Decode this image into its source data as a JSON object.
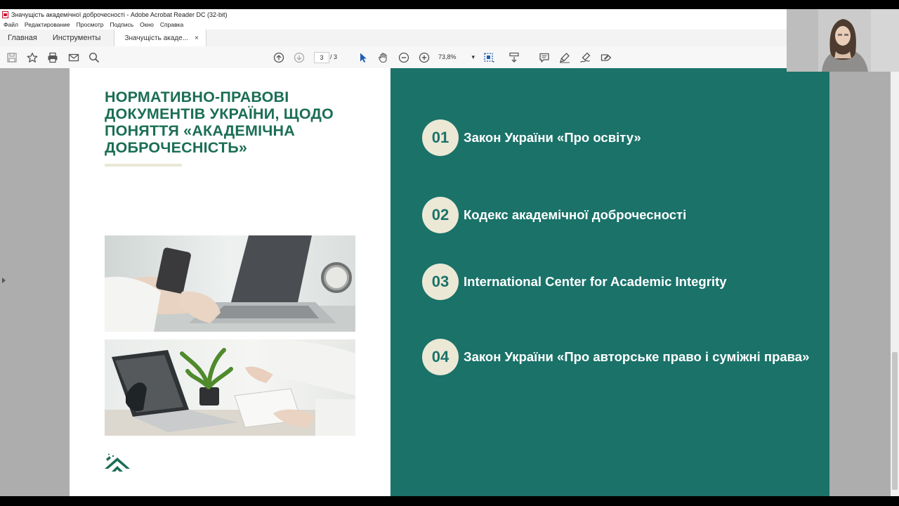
{
  "window": {
    "title": "Значущість академічної доброчесності - Adobe Acrobat Reader DC (32-bit)"
  },
  "menu": [
    "Файл",
    "Редактирование",
    "Просмотр",
    "Подпись",
    "Окно",
    "Справка"
  ],
  "tabs": {
    "home": "Главная",
    "tools": "Инструменты",
    "document": "Значущість акаде...",
    "close": "×"
  },
  "toolbar": {
    "current_page": "3",
    "total_pages": "/ 3",
    "zoom": "73,8%",
    "zoom_arrow": "▾"
  },
  "slide": {
    "title": "НОРМАТИВНО-ПРАВОВІ ДОКУМЕНТІВ УКРАЇНИ, ЩОДО ПОНЯТТЯ «АКАДЕМІЧНА ДОБРОЧЕСНІСТЬ»",
    "items": [
      {
        "num": "01",
        "label": "Закон України «Про освіту»"
      },
      {
        "num": "02",
        "label": "Кодекс академічної доброчесності"
      },
      {
        "num": "03",
        "label": "International Center for Academic Integrity"
      },
      {
        "num": "04",
        "label": "Закон України «Про авторське право і суміжні права»"
      }
    ]
  },
  "colors": {
    "slide_green": "#1a7269",
    "title_green": "#1b6e55",
    "badge_beige": "#ece8d6"
  }
}
